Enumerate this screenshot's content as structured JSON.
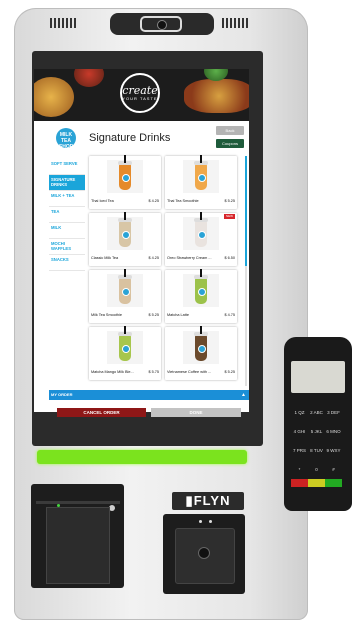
{
  "banner": {
    "logo_main": "create",
    "logo_sub": "YOUR TASTE"
  },
  "header": {
    "logo_text": "MILK TEA SHOP",
    "title": "Signature Drinks",
    "back_label": "Back",
    "coupons_label": "Coupons"
  },
  "sidebar": {
    "items": [
      {
        "label": "SOFT SERVE",
        "active": false
      },
      {
        "label": "SIGNATURE DRINKS",
        "active": true
      },
      {
        "label": "MILK + TEA",
        "active": false
      },
      {
        "label": "TEA",
        "active": false
      },
      {
        "label": "MILK",
        "active": false
      },
      {
        "label": "MOCHI WAFFLES",
        "active": false
      },
      {
        "label": "SNACKS",
        "active": false
      }
    ]
  },
  "products": [
    {
      "name": "Thai Iced Tea",
      "price": "$ 4.25",
      "badge": "",
      "color": "#e58a2a"
    },
    {
      "name": "Thai Tea Smoothie",
      "price": "$ 5.25",
      "badge": "",
      "color": "#f0a84a"
    },
    {
      "name": "Classic Milk Tea",
      "price": "$ 4.25",
      "badge": "",
      "color": "#d8c6a6"
    },
    {
      "name": "Oreo Strawberry Cream ...",
      "price": "$ 6.50",
      "badge": "NEW",
      "color": "#e9e3df"
    },
    {
      "name": "Milk Tea Smoothie",
      "price": "$ 5.25",
      "badge": "",
      "color": "#d9c2a0"
    },
    {
      "name": "Matcha Latte",
      "price": "$ 4.75",
      "badge": "",
      "color": "#9cc24a"
    },
    {
      "name": "Matcha Mango Milk Ble...",
      "price": "$ 5.75",
      "badge": "",
      "color": "#a7c64d"
    },
    {
      "name": "Vietnamese Coffee with ...",
      "price": "$ 5.25",
      "badge": "",
      "color": "#6b4a2c"
    }
  ],
  "order_bar": {
    "label": "MY ORDER"
  },
  "actions": {
    "cancel_label": "CANCEL ORDER",
    "done_label": "DONE"
  },
  "hardware": {
    "brand": "FLYN"
  },
  "terminal": {
    "keys": [
      "1 QZ",
      "2 ABC",
      "3 DEF",
      "4 GHI",
      "5 JKL",
      "6 MNO",
      "7 PRS",
      "8 TUV",
      "9 WXY",
      "*",
      "0",
      "#"
    ]
  },
  "colors": {
    "accent": "#1aa5da",
    "cancel": "#8e1717",
    "coupons": "#1e5b3b",
    "led": "#7be31e"
  }
}
